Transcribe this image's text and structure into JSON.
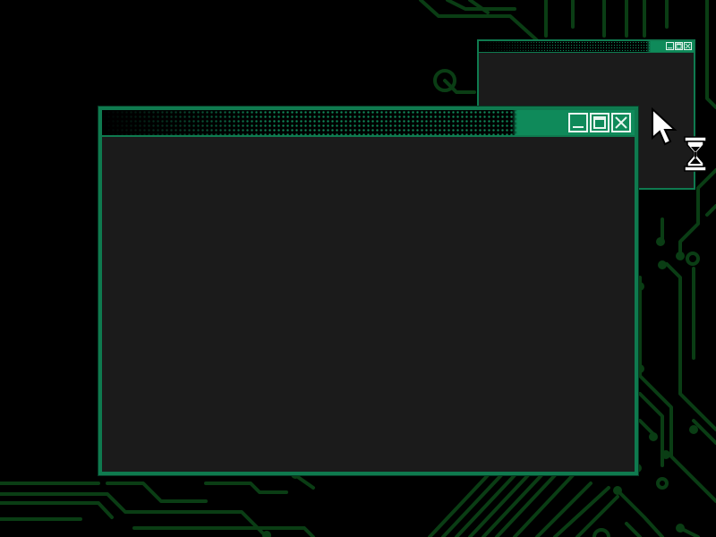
{
  "desktop": {
    "background": "#000000",
    "trace_color": "#0a3d14"
  },
  "windows": {
    "main": {
      "accent": "#0f8a5a",
      "controls": [
        {
          "name": "minimize",
          "icon": "minimize-icon"
        },
        {
          "name": "maximize",
          "icon": "maximize-icon"
        },
        {
          "name": "close",
          "icon": "close-icon"
        }
      ]
    },
    "secondary": {
      "accent": "#0f8a5a",
      "controls": [
        {
          "name": "minimize",
          "icon": "minimize-icon"
        },
        {
          "name": "maximize",
          "icon": "maximize-icon"
        },
        {
          "name": "close",
          "icon": "close-icon"
        }
      ]
    }
  },
  "pointer": {
    "arrow_icon": "arrow-cursor-icon",
    "busy_icon": "hourglass-icon"
  }
}
